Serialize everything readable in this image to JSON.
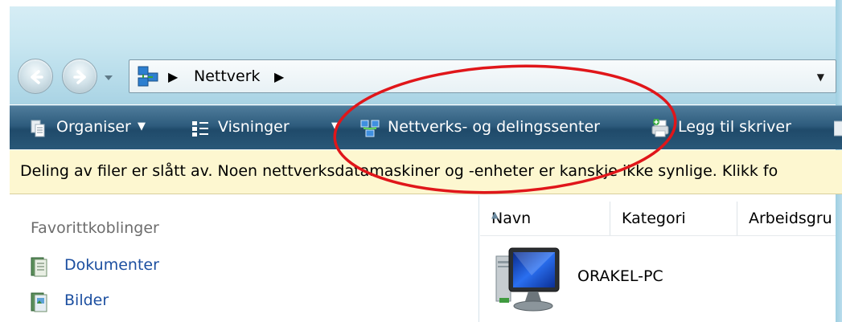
{
  "address_bar": {
    "breadcrumb": "Nettverk"
  },
  "toolbar": {
    "organize_label": "Organiser",
    "views_label": "Visninger",
    "network_center_label": "Nettverks- og delingssenter",
    "add_printer_label": "Legg til skriver"
  },
  "infobar": {
    "message": "Deling av filer er slått av. Noen nettverksdatamaskiner og -enheter er kanskje ikke synlige. Klikk fo"
  },
  "nav_pane": {
    "title": "Favorittkoblinger",
    "links": [
      {
        "label": "Dokumenter",
        "icon": "documents-icon"
      },
      {
        "label": "Bilder",
        "icon": "pictures-icon"
      }
    ]
  },
  "content": {
    "columns": [
      "Navn",
      "Kategori",
      "Arbeidsgru"
    ],
    "sorted_column": "Navn",
    "items": [
      {
        "name": "ORAKEL-PC",
        "icon": "computer-icon"
      }
    ]
  },
  "colors": {
    "toolbar_bg": "#2e5c7d",
    "infobar_bg": "#fdf7d0",
    "link_color": "#1c4fa0",
    "annotation": "#e0161a"
  }
}
